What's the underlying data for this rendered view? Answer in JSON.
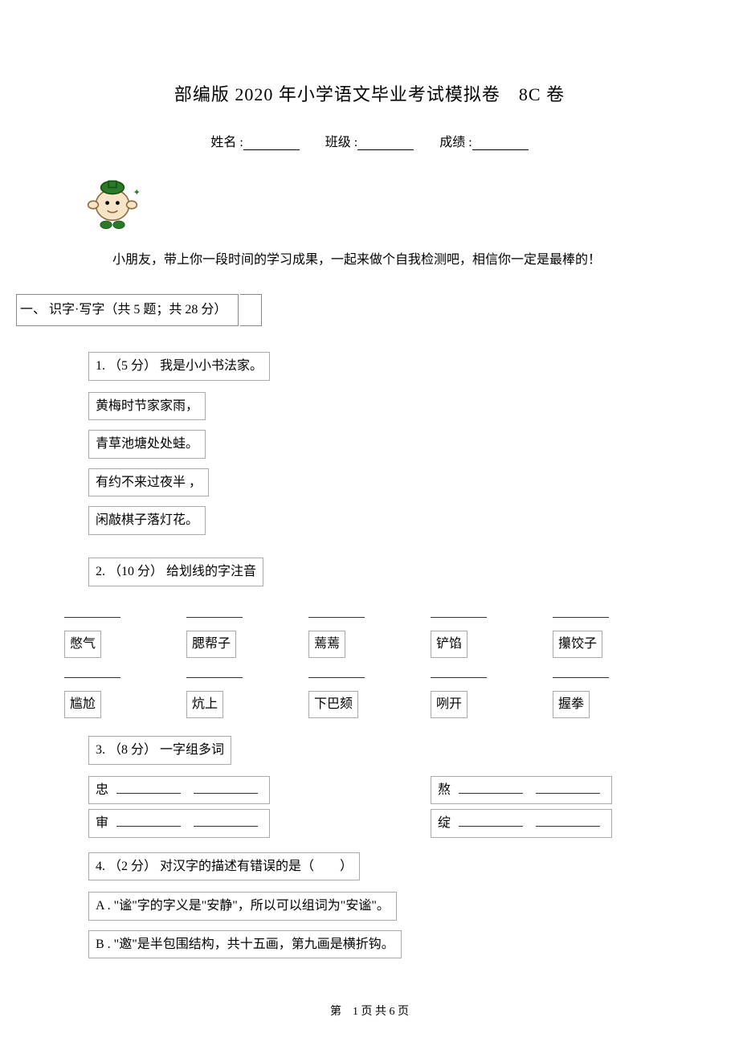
{
  "title": "部编版 2020 年小学语文毕业考试模拟卷　8C 卷",
  "info": {
    "name_label": "姓名 :",
    "class_label": "班级 :",
    "score_label": "成绩 :"
  },
  "encouragement": "小朋友，带上你一段时间的学习成果，一起来做个自我检测吧，相信你一定是最棒的！",
  "section1": {
    "heading": "一、 识字·写字（共 5 题；共 28 分）",
    "q1": {
      "label": "1. （5 分） 我是小小书法家。",
      "lines": [
        "黄梅时节家家雨，",
        "青草池塘处处蛙。",
        "有约不来过夜半 ，",
        "闲敲棋子落灯花。"
      ]
    },
    "q2": {
      "label": "2. （10 分） 给划线的字注音",
      "row1": [
        "憋气",
        "腮帮子",
        "蔫蔫",
        "铲馅",
        "攥饺子"
      ],
      "row2": [
        "尴尬",
        "炕上",
        "下巴颏",
        "咧开",
        "握拳"
      ]
    },
    "q3": {
      "label": "3. （8 分） 一字组多词",
      "pairs": [
        {
          "left": "忠",
          "right": "熬"
        },
        {
          "left": "审",
          "right": "绽"
        }
      ]
    },
    "q4": {
      "label": "4. （2 分） 对汉字的描述有错误的是（　　）",
      "optA": "A . \"谧\"字的字义是\"安静\"，所以可以组词为\"安谧\"。",
      "optB": "B . \"邀\"是半包围结构，共十五画，第九画是横折钩。"
    }
  },
  "footer": "第　1 页 共 6 页"
}
